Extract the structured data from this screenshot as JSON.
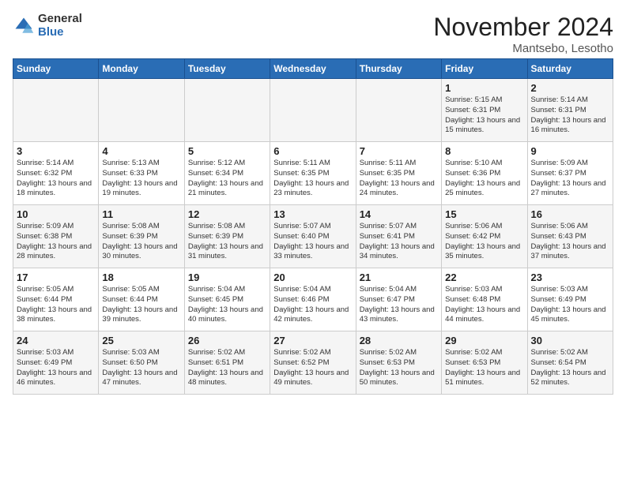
{
  "logo": {
    "general": "General",
    "blue": "Blue"
  },
  "header": {
    "month_year": "November 2024",
    "location": "Mantsebo, Lesotho"
  },
  "days_of_week": [
    "Sunday",
    "Monday",
    "Tuesday",
    "Wednesday",
    "Thursday",
    "Friday",
    "Saturday"
  ],
  "weeks": [
    [
      {
        "day": "",
        "info": ""
      },
      {
        "day": "",
        "info": ""
      },
      {
        "day": "",
        "info": ""
      },
      {
        "day": "",
        "info": ""
      },
      {
        "day": "",
        "info": ""
      },
      {
        "day": "1",
        "info": "Sunrise: 5:15 AM\nSunset: 6:31 PM\nDaylight: 13 hours and 15 minutes."
      },
      {
        "day": "2",
        "info": "Sunrise: 5:14 AM\nSunset: 6:31 PM\nDaylight: 13 hours and 16 minutes."
      }
    ],
    [
      {
        "day": "3",
        "info": "Sunrise: 5:14 AM\nSunset: 6:32 PM\nDaylight: 13 hours and 18 minutes."
      },
      {
        "day": "4",
        "info": "Sunrise: 5:13 AM\nSunset: 6:33 PM\nDaylight: 13 hours and 19 minutes."
      },
      {
        "day": "5",
        "info": "Sunrise: 5:12 AM\nSunset: 6:34 PM\nDaylight: 13 hours and 21 minutes."
      },
      {
        "day": "6",
        "info": "Sunrise: 5:11 AM\nSunset: 6:35 PM\nDaylight: 13 hours and 23 minutes."
      },
      {
        "day": "7",
        "info": "Sunrise: 5:11 AM\nSunset: 6:35 PM\nDaylight: 13 hours and 24 minutes."
      },
      {
        "day": "8",
        "info": "Sunrise: 5:10 AM\nSunset: 6:36 PM\nDaylight: 13 hours and 25 minutes."
      },
      {
        "day": "9",
        "info": "Sunrise: 5:09 AM\nSunset: 6:37 PM\nDaylight: 13 hours and 27 minutes."
      }
    ],
    [
      {
        "day": "10",
        "info": "Sunrise: 5:09 AM\nSunset: 6:38 PM\nDaylight: 13 hours and 28 minutes."
      },
      {
        "day": "11",
        "info": "Sunrise: 5:08 AM\nSunset: 6:39 PM\nDaylight: 13 hours and 30 minutes."
      },
      {
        "day": "12",
        "info": "Sunrise: 5:08 AM\nSunset: 6:39 PM\nDaylight: 13 hours and 31 minutes."
      },
      {
        "day": "13",
        "info": "Sunrise: 5:07 AM\nSunset: 6:40 PM\nDaylight: 13 hours and 33 minutes."
      },
      {
        "day": "14",
        "info": "Sunrise: 5:07 AM\nSunset: 6:41 PM\nDaylight: 13 hours and 34 minutes."
      },
      {
        "day": "15",
        "info": "Sunrise: 5:06 AM\nSunset: 6:42 PM\nDaylight: 13 hours and 35 minutes."
      },
      {
        "day": "16",
        "info": "Sunrise: 5:06 AM\nSunset: 6:43 PM\nDaylight: 13 hours and 37 minutes."
      }
    ],
    [
      {
        "day": "17",
        "info": "Sunrise: 5:05 AM\nSunset: 6:44 PM\nDaylight: 13 hours and 38 minutes."
      },
      {
        "day": "18",
        "info": "Sunrise: 5:05 AM\nSunset: 6:44 PM\nDaylight: 13 hours and 39 minutes."
      },
      {
        "day": "19",
        "info": "Sunrise: 5:04 AM\nSunset: 6:45 PM\nDaylight: 13 hours and 40 minutes."
      },
      {
        "day": "20",
        "info": "Sunrise: 5:04 AM\nSunset: 6:46 PM\nDaylight: 13 hours and 42 minutes."
      },
      {
        "day": "21",
        "info": "Sunrise: 5:04 AM\nSunset: 6:47 PM\nDaylight: 13 hours and 43 minutes."
      },
      {
        "day": "22",
        "info": "Sunrise: 5:03 AM\nSunset: 6:48 PM\nDaylight: 13 hours and 44 minutes."
      },
      {
        "day": "23",
        "info": "Sunrise: 5:03 AM\nSunset: 6:49 PM\nDaylight: 13 hours and 45 minutes."
      }
    ],
    [
      {
        "day": "24",
        "info": "Sunrise: 5:03 AM\nSunset: 6:49 PM\nDaylight: 13 hours and 46 minutes."
      },
      {
        "day": "25",
        "info": "Sunrise: 5:03 AM\nSunset: 6:50 PM\nDaylight: 13 hours and 47 minutes."
      },
      {
        "day": "26",
        "info": "Sunrise: 5:02 AM\nSunset: 6:51 PM\nDaylight: 13 hours and 48 minutes."
      },
      {
        "day": "27",
        "info": "Sunrise: 5:02 AM\nSunset: 6:52 PM\nDaylight: 13 hours and 49 minutes."
      },
      {
        "day": "28",
        "info": "Sunrise: 5:02 AM\nSunset: 6:53 PM\nDaylight: 13 hours and 50 minutes."
      },
      {
        "day": "29",
        "info": "Sunrise: 5:02 AM\nSunset: 6:53 PM\nDaylight: 13 hours and 51 minutes."
      },
      {
        "day": "30",
        "info": "Sunrise: 5:02 AM\nSunset: 6:54 PM\nDaylight: 13 hours and 52 minutes."
      }
    ]
  ]
}
